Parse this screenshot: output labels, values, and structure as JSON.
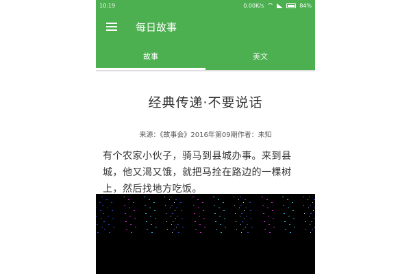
{
  "status_bar": {
    "time": "10:19",
    "network_speed": "0.00K/s",
    "battery": "84%"
  },
  "app_bar": {
    "title": "每日故事"
  },
  "tabs": [
    {
      "label": "故事",
      "active": true
    },
    {
      "label": "美文",
      "active": false
    }
  ],
  "article": {
    "title": "经典传递·不要说话",
    "meta": "来源：《故事会》2016年第09期作者：未知",
    "body": "有个农家小伙子，骑马到县城办事。来到县城，他又渴又饿，就把马拴在路边的一棵树上，然后找地方吃饭。"
  },
  "colors": {
    "primary": "#4caf50",
    "text": "#333333"
  }
}
